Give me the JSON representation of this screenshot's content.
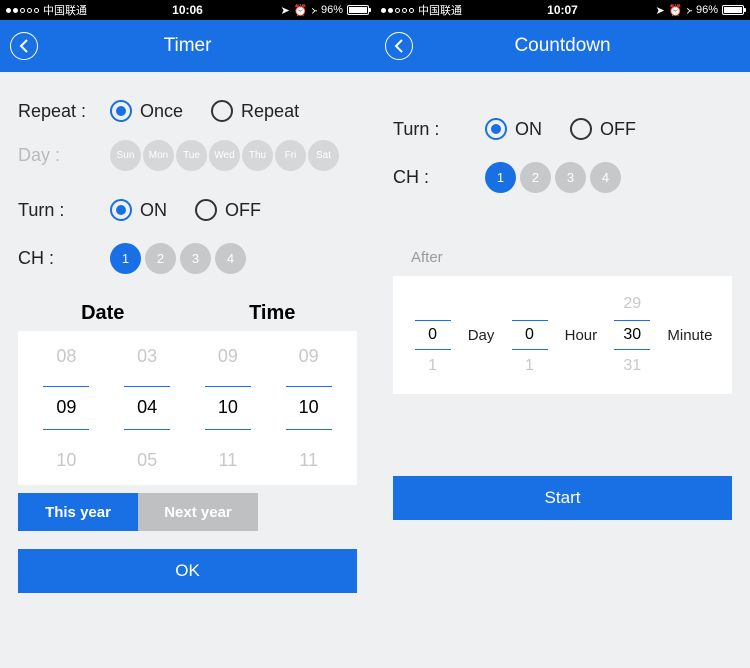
{
  "left": {
    "status": {
      "carrier": "中国联通",
      "time": "10:06",
      "battery_pct": "96%"
    },
    "header": {
      "title": "Timer"
    },
    "repeat": {
      "label": "Repeat :",
      "opt_once": "Once",
      "opt_repeat": "Repeat",
      "selected": "once"
    },
    "day": {
      "label": "Day :",
      "names": [
        "Sun",
        "Mon",
        "Tue",
        "Wed",
        "Thu",
        "Fri",
        "Sat"
      ]
    },
    "turn": {
      "label": "Turn :",
      "opt_on": "ON",
      "opt_off": "OFF",
      "selected": "on"
    },
    "ch": {
      "label": "CH  :",
      "items": [
        "1",
        "2",
        "3",
        "4"
      ],
      "selected": 0
    },
    "dt": {
      "date_label": "Date",
      "time_label": "Time",
      "month": {
        "prev": "08",
        "cur": "09",
        "next": "10"
      },
      "dayn": {
        "prev": "03",
        "cur": "04",
        "next": "05"
      },
      "hour": {
        "prev": "09",
        "cur": "10",
        "next": "11"
      },
      "min": {
        "prev": "09",
        "cur": "10",
        "next": "11"
      }
    },
    "year_tabs": {
      "this": "This year",
      "next": "Next year",
      "active": "this"
    },
    "ok": "OK"
  },
  "right": {
    "status": {
      "carrier": "中国联通",
      "time": "10:07",
      "battery_pct": "96%"
    },
    "header": {
      "title": "Countdown"
    },
    "turn": {
      "label": "Turn :",
      "opt_on": "ON",
      "opt_off": "OFF",
      "selected": "on"
    },
    "ch": {
      "label": "CH  :",
      "items": [
        "1",
        "2",
        "3",
        "4"
      ],
      "selected": 0
    },
    "after_label": "After",
    "after": {
      "day": {
        "prev": "",
        "cur": "0",
        "next": "1",
        "unit": "Day"
      },
      "hour": {
        "prev": "",
        "cur": "0",
        "next": "1",
        "unit": "Hour"
      },
      "min": {
        "prev": "29",
        "cur": "30",
        "next": "31",
        "unit": "Minute"
      }
    },
    "start": "Start"
  }
}
